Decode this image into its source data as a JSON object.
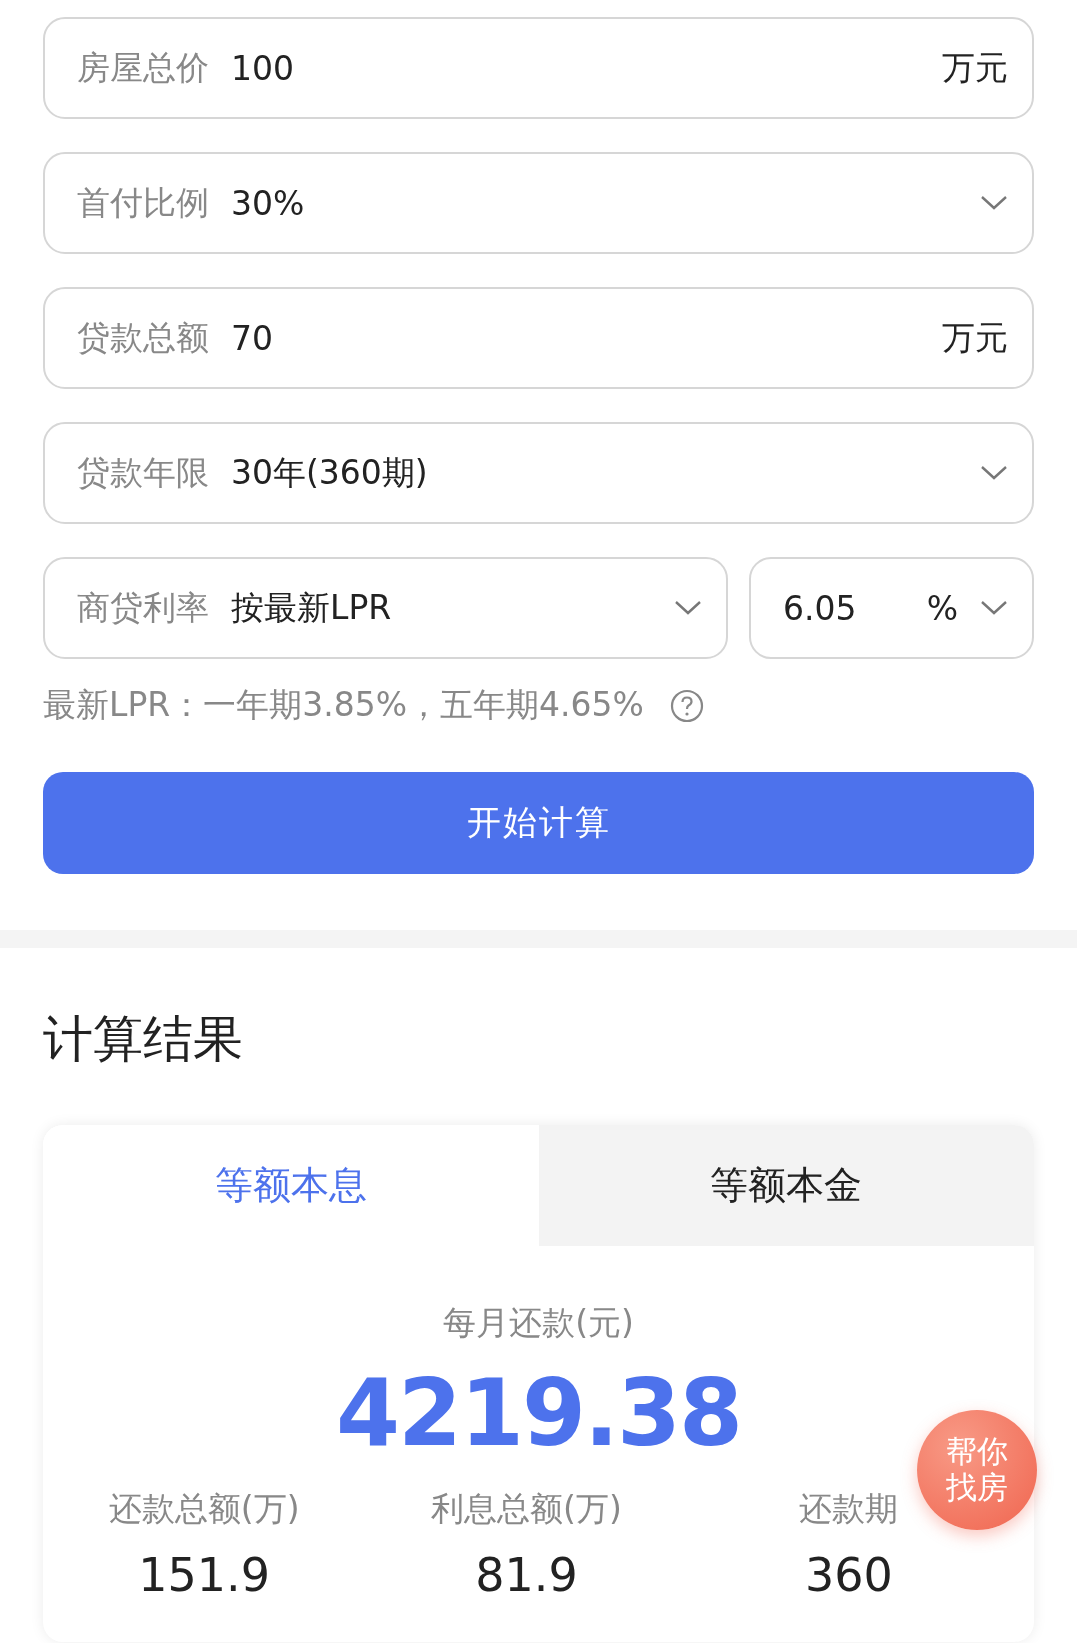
{
  "form": {
    "fields": [
      {
        "kind": "input",
        "label": "房屋总价",
        "value": "100",
        "unit": "万元"
      },
      {
        "kind": "select",
        "label": "首付比例",
        "value": "30%"
      },
      {
        "kind": "input",
        "label": "贷款总额",
        "value": "70",
        "unit": "万元"
      },
      {
        "kind": "select",
        "label": "贷款年限",
        "value": "30年(360期)"
      }
    ],
    "rate": {
      "label": "商贷利率",
      "value": "按最新LPR",
      "rate_value": "6.05",
      "rate_unit": "%"
    },
    "lpr_note": "最新LPR：一年期3.85%，五年期4.65%",
    "submit": "开始计算"
  },
  "results": {
    "title": "计算结果",
    "tabs": [
      {
        "label": "等额本息",
        "selected": true
      },
      {
        "label": "等额本金",
        "selected": false
      }
    ],
    "monthly_label": "每月还款(元)",
    "monthly_value": "4219.38",
    "stats": [
      {
        "label": "还款总额(万)",
        "value": "151.9"
      },
      {
        "label": "利息总额(万)",
        "value": "81.9"
      },
      {
        "label": "还款期",
        "value": "360"
      }
    ]
  },
  "float_button": {
    "line1": "帮你",
    "line2": "找房"
  }
}
